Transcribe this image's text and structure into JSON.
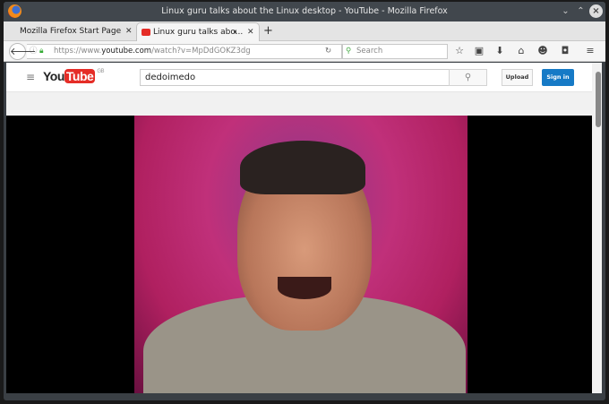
{
  "window": {
    "title": "Linux guru talks about the Linux desktop - YouTube - Mozilla Firefox"
  },
  "tabs": [
    {
      "label": "Mozilla Firefox Start Page"
    },
    {
      "label": "Linux guru talks abo..."
    }
  ],
  "navbar": {
    "url_prefix": "https://www.",
    "url_domain": "youtube.com",
    "url_path": "/watch?v=MpDdGOKZ3dg",
    "search_placeholder": "Search"
  },
  "youtube": {
    "logo_you": "You",
    "logo_tube": "Tube",
    "region": "GB",
    "search_value": "dedoimedo",
    "upload_label": "Upload",
    "signin_label": "Sign in"
  }
}
